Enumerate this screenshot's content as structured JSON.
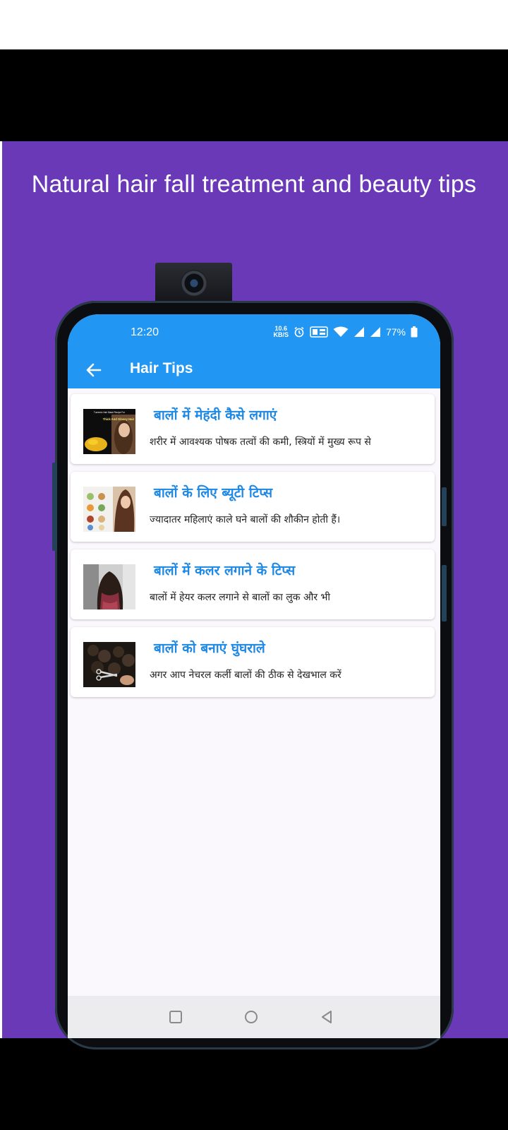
{
  "promo": {
    "headline": "Natural hair fall treatment and beauty tips",
    "background_color": "#6a39b8"
  },
  "status_bar": {
    "time": "12:20",
    "icons": [
      "data-speed-icon",
      "alarm-icon",
      "nfc-icon",
      "wifi-icon",
      "signal-icon",
      "signal-icon",
      "battery-icon"
    ],
    "data_speed": "10.6",
    "battery": "77%"
  },
  "app_bar": {
    "title": "Hair Tips",
    "color": "#2196f3",
    "back_icon": "arrow-back-icon"
  },
  "tips": [
    {
      "title": "बालों में मेहंदी कैसे लगाएं",
      "snippet": "शरीर में आवश्यक पोषक तत्वों की कमी, स्त्रियों में मुख्य रूप से"
    },
    {
      "title": "बालों के लिए ब्यूटी टिप्स",
      "snippet": "ज्यादातर महिलाएं काले घने बालों की शौकीन होती हैं।"
    },
    {
      "title": "बालों में कलर लगाने के टिप्स",
      "snippet": "बालों में हेयर कलर लगाने से बालों का लुक और भी"
    },
    {
      "title": "बालों को बनाएं घुंघराले",
      "snippet": "अगर आप नेचरल कर्ली बालों की ठीक से देखभाल करें"
    }
  ],
  "thumb1": {
    "caption_top": "Turmeric Hair Mask Recipe For",
    "caption_main": "Thick And Glossy Hair"
  },
  "nav_bar": {
    "buttons": [
      "square-recents-icon",
      "circle-home-icon",
      "triangle-back-icon"
    ]
  }
}
